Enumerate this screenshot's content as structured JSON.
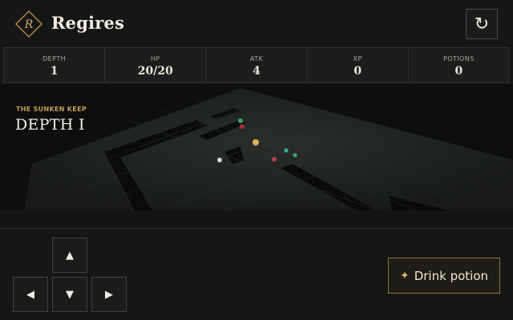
{
  "app": {
    "title": "Regires",
    "logo_letter": "R",
    "restart_icon": "↻"
  },
  "stats": [
    {
      "label": "DEPTH",
      "value": "1"
    },
    {
      "label": "HP",
      "value": "20/20"
    },
    {
      "label": "ATK",
      "value": "4"
    },
    {
      "label": "XP",
      "value": "0"
    },
    {
      "label": "POTIONS",
      "value": "0"
    }
  ],
  "level": {
    "area": "THE SUNKEN KEEP",
    "title": "DEPTH I"
  },
  "controls": {
    "up": "▲",
    "left": "◀",
    "down": "▼",
    "right": "▶",
    "potion_icon": "✦",
    "potion_label": "Drink potion"
  },
  "colors": {
    "accent_gold": "#c49a58",
    "background": "#151716",
    "panel": "#1c1e1d"
  }
}
